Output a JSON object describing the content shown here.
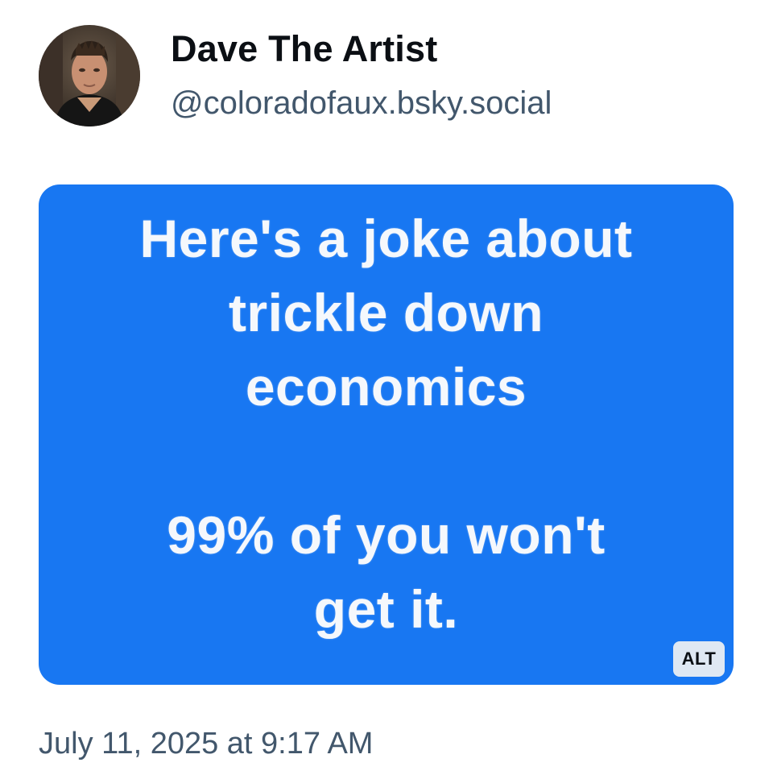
{
  "author": {
    "display_name": "Dave The Artist",
    "handle": "@coloradofaux.bsky.social",
    "avatar_icon": "user-avatar-photo"
  },
  "media": {
    "background_color": "#1877f2",
    "text_color": "#f5f8fc",
    "text_lines": [
      "Here's a joke about",
      "trickle down",
      "economics",
      "",
      "99% of you won't",
      "get it."
    ],
    "alt_label": "ALT"
  },
  "timestamp": "July 11, 2025 at 9:17 AM"
}
